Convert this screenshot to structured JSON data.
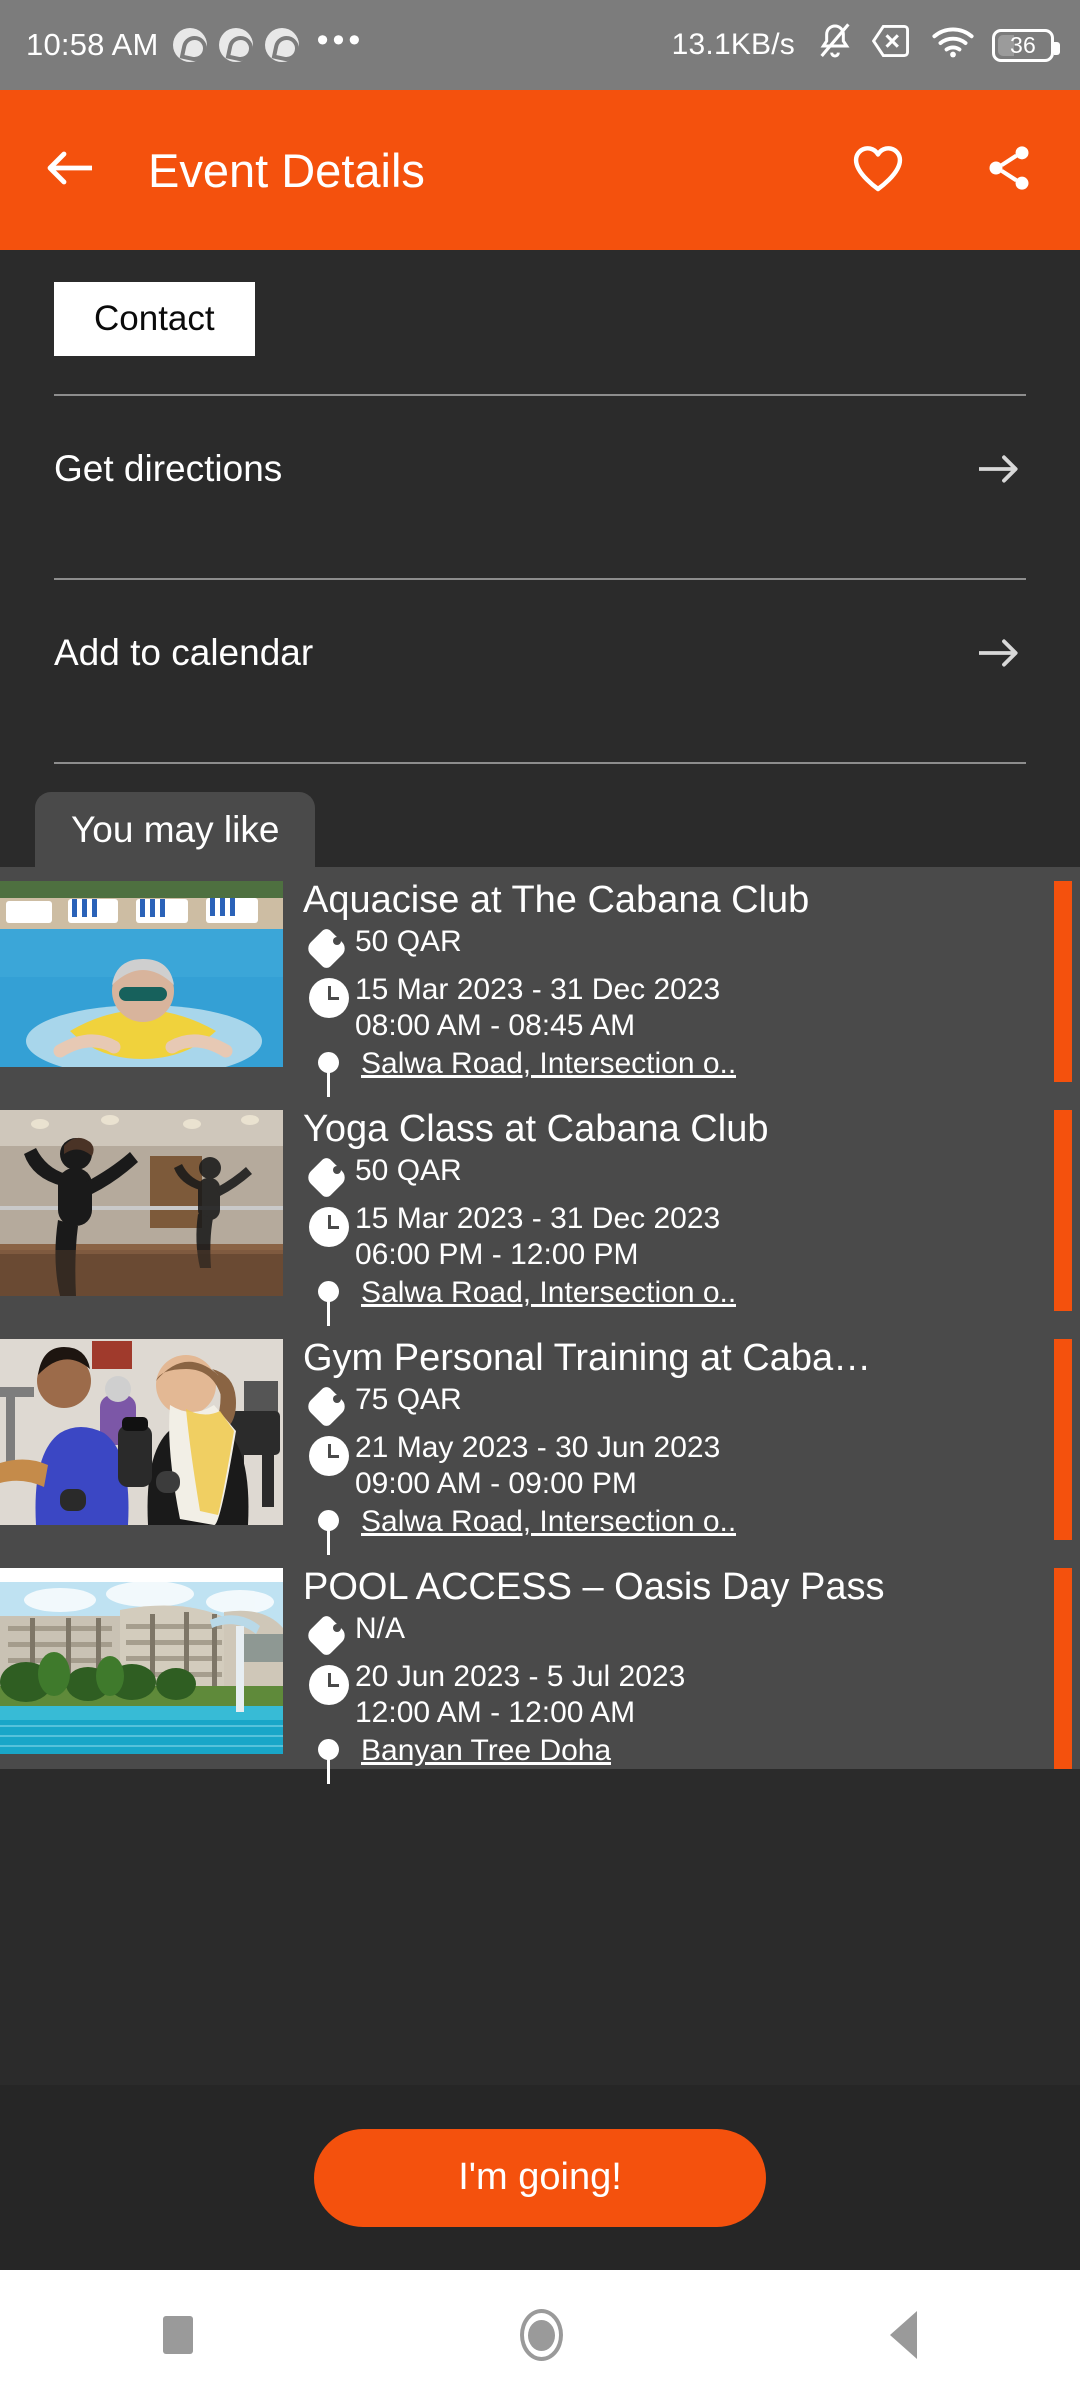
{
  "status_bar": {
    "time": "10:58 AM",
    "dots": "•••",
    "network_speed": "13.1KB/s",
    "battery_level": "36",
    "icons": [
      "chrome-icon",
      "chrome-icon",
      "chrome-icon",
      "overflow-dots-icon",
      "silent-bell-icon",
      "sim-missing-icon",
      "wifi-icon",
      "battery-icon"
    ]
  },
  "app_bar": {
    "title": "Event Details",
    "back_icon": "back-arrow-icon",
    "favorite_icon": "heart-icon",
    "share_icon": "share-icon",
    "background": "#f4510d"
  },
  "detail": {
    "contact_label": "Contact",
    "rows": [
      {
        "label": "Get directions",
        "arrow_icon": "arrow-right-icon"
      },
      {
        "label": "Add to calendar",
        "arrow_icon": "arrow-right-icon"
      }
    ]
  },
  "you_may_like": {
    "tab_label": "You may like",
    "accent_color": "#f4510d",
    "cards": [
      {
        "title": "Aquacise at The Cabana Club",
        "price": "50 QAR",
        "date_range": "15 Mar 2023 - 31 Dec 2023",
        "time_range": "08:00 AM - 08:45 AM",
        "location": "Salwa Road, Intersection o..",
        "image": "woman-in-pool-with-yellow-noodle"
      },
      {
        "title": "Yoga Class at Cabana Club",
        "price": "50 QAR",
        "date_range": "15 Mar 2023 - 31 Dec 2023",
        "time_range": "06:00 PM - 12:00 PM",
        "location": "Salwa Road, Intersection o..",
        "image": "woman-doing-yoga-pose-in-mirrored-studio"
      },
      {
        "title": "Gym Personal Training at Caba…",
        "price": "75 QAR",
        "date_range": "21 May 2023 - 30 Jun 2023",
        "time_range": "09:00 AM - 09:00 PM",
        "location": "Salwa Road, Intersection o..",
        "image": "trainer-with-client-in-gym"
      },
      {
        "title": "POOL ACCESS – Oasis Day Pass",
        "price": "N/A",
        "date_range": "20 Jun 2023 - 5 Jul 2023",
        "time_range": "12:00 AM - 12:00 AM",
        "location": "Banyan Tree Doha",
        "image": "resort-pool-with-curved-building"
      }
    ]
  },
  "cta": {
    "label": "I'm going!"
  },
  "nav_bar": {
    "recents_icon": "square-icon",
    "home_icon": "circle-icon",
    "back_icon": "triangle-back-icon"
  }
}
